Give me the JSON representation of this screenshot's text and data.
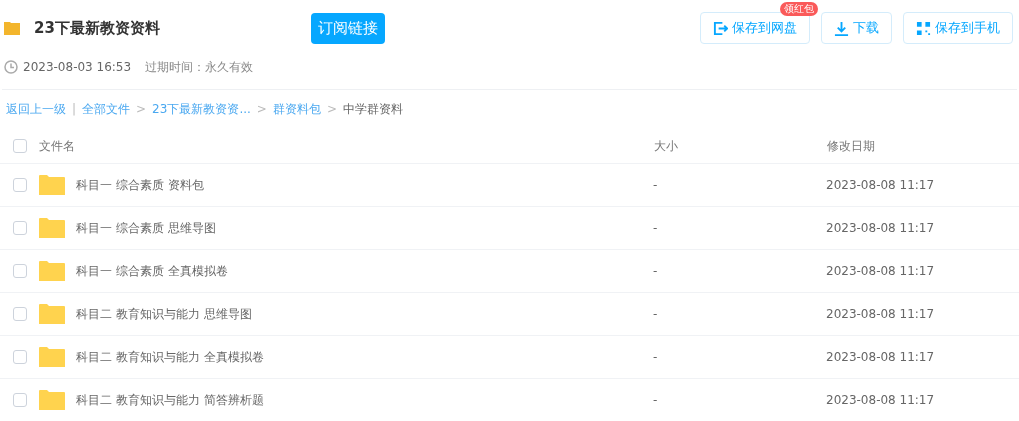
{
  "header": {
    "title": "23下最新教资资料",
    "subscribe_button": "订阅链接",
    "actions": [
      {
        "kind": "save",
        "label": "保存到网盘",
        "badge": "领红包"
      },
      {
        "kind": "download",
        "label": "下载"
      },
      {
        "kind": "phone",
        "label": "保存到手机"
      }
    ]
  },
  "meta": {
    "time": "2023-08-03 16:53",
    "expiry": "过期时间：永久有效"
  },
  "breadcrumb": [
    {
      "label": "返回上一级",
      "kind": "link"
    },
    {
      "label": "|",
      "kind": "sep"
    },
    {
      "label": "全部文件",
      "kind": "link"
    },
    {
      "label": ">",
      "kind": "sep"
    },
    {
      "label": "23下最新教资资...",
      "kind": "link"
    },
    {
      "label": ">",
      "kind": "sep"
    },
    {
      "label": "群资料包",
      "kind": "link"
    },
    {
      "label": ">",
      "kind": "sep"
    },
    {
      "label": "中学群资料",
      "kind": "current"
    }
  ],
  "table": {
    "columns": [
      "文件名",
      "大小",
      "修改日期"
    ],
    "header_checked": false,
    "rows": [
      {
        "name": "科目一 综合素质 资料包",
        "size": "-",
        "date": "2023-08-08 11:17",
        "checked": false
      },
      {
        "name": "科目一 综合素质 思维导图",
        "size": "-",
        "date": "2023-08-08 11:17",
        "checked": false
      },
      {
        "name": "科目一 综合素质 全真模拟卷",
        "size": "-",
        "date": "2023-08-08 11:17",
        "checked": false
      },
      {
        "name": "科目二 教育知识与能力 思维导图",
        "size": "-",
        "date": "2023-08-08 11:17",
        "checked": false
      },
      {
        "name": "科目二 教育知识与能力 全真模拟卷",
        "size": "-",
        "date": "2023-08-08 11:17",
        "checked": false
      },
      {
        "name": "科目二 教育知识与能力 简答辨析题",
        "size": "-",
        "date": "2023-08-08 11:17",
        "checked": false
      }
    ]
  }
}
